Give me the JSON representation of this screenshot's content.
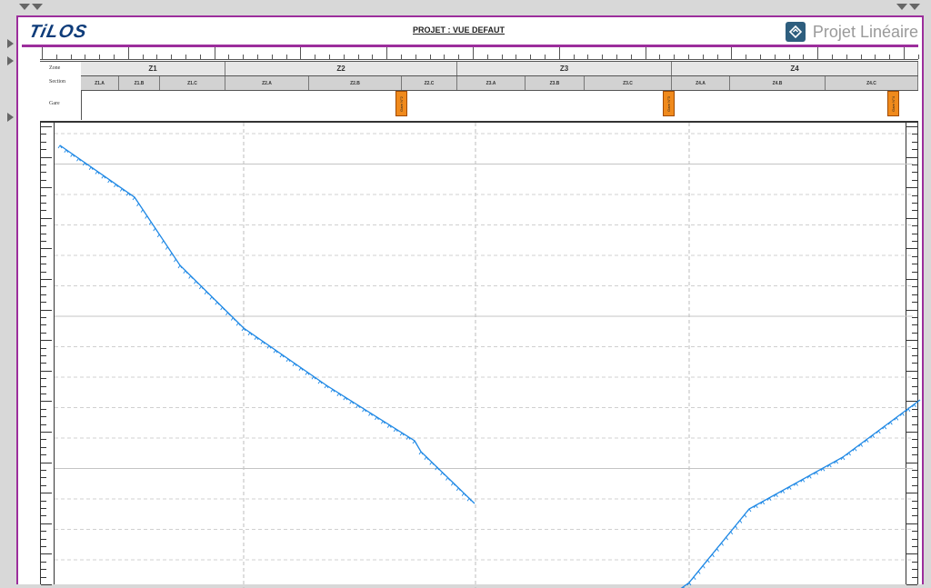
{
  "app": {
    "logo": "TiLOS",
    "project_title": "PROJET : VUE DEFAUT",
    "brand_label": "Projet Linéaire"
  },
  "table": {
    "row_labels": {
      "zone": "Zone",
      "section": "Section",
      "gare": "Gare"
    },
    "zones": [
      "Z1",
      "Z2",
      "Z3",
      "Z4"
    ],
    "sections": [
      "Z1.A",
      "Z1.B",
      "Z1.C",
      "Z2.A",
      "Z2.B",
      "Z2.C",
      "Z3.A",
      "Z3.B",
      "Z3.C",
      "Z4.A",
      "Z4.B",
      "Z4.C"
    ],
    "gares": [
      "Gare N°2",
      "Gare N°3",
      "Gare N°4"
    ]
  },
  "colors": {
    "accent": "#9c2e9c",
    "line": "#1e88e5",
    "gare": "#f08a1c",
    "logo": "#0e3c7a"
  },
  "icons": [
    "collapse-arrow-icon",
    "expand-arrow-icon",
    "projet-lineaire-logo-icon"
  ]
}
